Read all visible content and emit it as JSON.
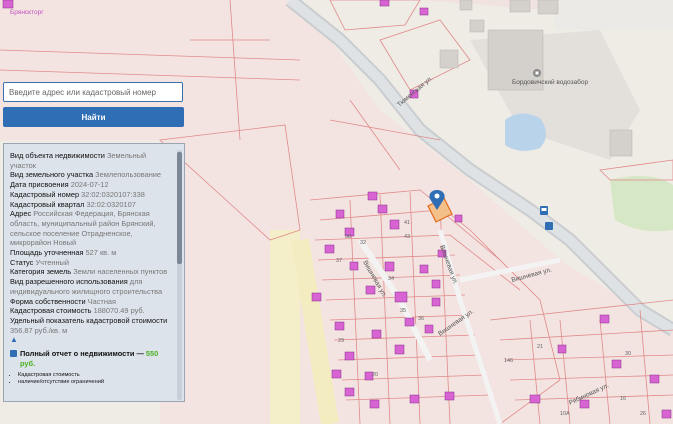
{
  "search": {
    "placeholder": "Введите адрес или кадастровый номер",
    "button_label": "Найти"
  },
  "info": {
    "rows": [
      {
        "key": "Вид объекта недвижимости",
        "value": "Земельный участок"
      },
      {
        "key": "Вид земельного участка",
        "value": "Землепользование"
      },
      {
        "key": "Дата присвоения",
        "value": "2024-07-12"
      },
      {
        "key": "Кадастровый номер",
        "value": "32:02:0320107:338"
      },
      {
        "key": "Кадастровый квартал",
        "value": "32:02:0320107"
      },
      {
        "key": "Адрес",
        "value": "Российская Федерация, Брянская область, муниципальный район Брянский, сельское поселение Отрадненское, микрорайон Новый"
      },
      {
        "key": "Площадь уточненная",
        "value": "527 кв. м"
      },
      {
        "key": "Статус",
        "value": "Учтенный"
      },
      {
        "key": "Категория земель",
        "value": "Земли населенных пунктов"
      },
      {
        "key": "Вид разрешенного использования",
        "value": "для индивидуального жилищного строительства"
      },
      {
        "key": "Форма собственности",
        "value": "Частная"
      },
      {
        "key": "Кадастровая стоимость",
        "value": "188070.49 руб."
      },
      {
        "key": "Удельный показатель кадастровой стоимости",
        "value": "356.87 руб./кв. м"
      }
    ],
    "collapse_glyph": "▲",
    "full_report_text": "Полный отчет о недвижимости —",
    "full_report_price": "550 руб.",
    "report_items": [
      "Кадастровая стоимость",
      "наличие/отсутствие ограничений"
    ]
  },
  "map": {
    "street_labels": [
      "Тюменская ул.",
      "Вишневая ул.",
      "Вишневая ул.",
      "Вишневая ул.",
      "Вишневая ул.",
      "Рябиновая ул."
    ],
    "poi_label": "Бордовичский водозабор",
    "corner_label": "Брянскторг",
    "parcel_numbers": [
      "41",
      "43",
      "32",
      "34",
      "36",
      "38",
      "37",
      "29",
      "20",
      "35",
      "146",
      "21",
      "10A",
      "30",
      "16",
      "26"
    ],
    "colors": {
      "parcel_line": "#e08a8a",
      "road": "#d3d6d8",
      "accent": "#2f6db5",
      "price": "#4bb020"
    }
  }
}
